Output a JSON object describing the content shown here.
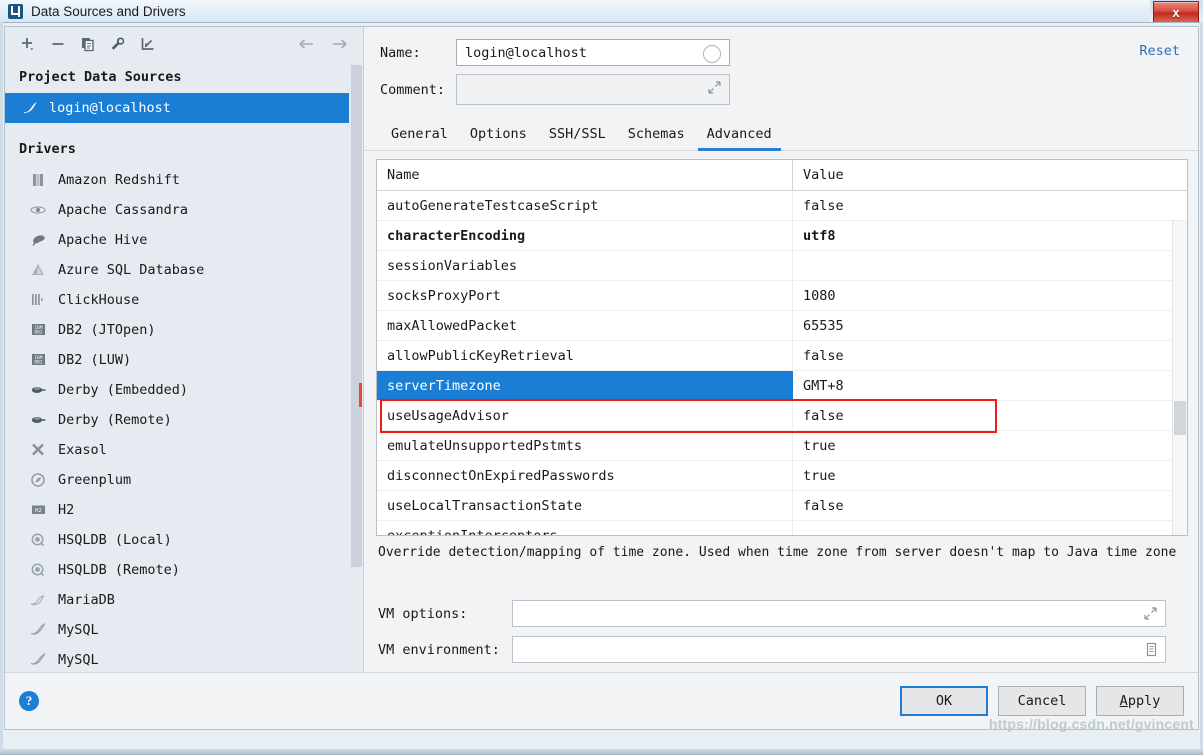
{
  "window": {
    "title": "Data Sources and Drivers",
    "logo_icon": "intellij-idea-logo-icon",
    "close_label": "x"
  },
  "left_panel": {
    "toolbar": [
      {
        "name": "add-button",
        "icon": "plus-icon",
        "label": "+"
      },
      {
        "name": "remove-button",
        "icon": "minus-icon",
        "label": "−"
      },
      {
        "name": "copy-button",
        "icon": "copy-icon",
        "label": "copy"
      },
      {
        "name": "properties-button",
        "icon": "wrench-icon",
        "label": "wrench"
      },
      {
        "name": "import-button",
        "icon": "import-arrow-icon",
        "label": "import"
      },
      {
        "name": "back-button",
        "icon": "arrow-left-icon",
        "label": "←"
      },
      {
        "name": "forward-button",
        "icon": "arrow-right-icon",
        "label": "→"
      }
    ],
    "project_group_label": "Project Data Sources",
    "data_sources": [
      {
        "label": "login@localhost",
        "icon": "mysql-dolphin-icon",
        "selected": true
      }
    ],
    "drivers_group_label": "Drivers",
    "drivers": [
      {
        "label": "Amazon Redshift",
        "icon": "amazon-redshift-icon"
      },
      {
        "label": "Apache Cassandra",
        "icon": "apache-cassandra-icon"
      },
      {
        "label": "Apache Hive",
        "icon": "apache-hive-icon"
      },
      {
        "label": "Azure SQL Database",
        "icon": "azure-sql-icon"
      },
      {
        "label": "ClickHouse",
        "icon": "clickhouse-icon"
      },
      {
        "label": "DB2 (JTOpen)",
        "icon": "ibm-db2-icon"
      },
      {
        "label": "DB2 (LUW)",
        "icon": "ibm-db2-icon"
      },
      {
        "label": "Derby (Embedded)",
        "icon": "derby-icon"
      },
      {
        "label": "Derby (Remote)",
        "icon": "derby-icon"
      },
      {
        "label": "Exasol",
        "icon": "exasol-icon"
      },
      {
        "label": "Greenplum",
        "icon": "greenplum-icon"
      },
      {
        "label": "H2",
        "icon": "h2-icon"
      },
      {
        "label": "HSQLDB (Local)",
        "icon": "hsqldb-icon"
      },
      {
        "label": "HSQLDB (Remote)",
        "icon": "hsqldb-icon"
      },
      {
        "label": "MariaDB",
        "icon": "mariadb-seal-icon"
      },
      {
        "label": "MySQL",
        "icon": "mysql-dolphin-icon"
      },
      {
        "label": "MySQL",
        "icon": "mysql-dolphin-icon"
      }
    ]
  },
  "right_panel": {
    "name_label": "Name:",
    "name_value": "login@localhost",
    "name_placeholder": "",
    "comment_label": "Comment:",
    "comment_value": "",
    "comment_placeholder": "",
    "reset_label": "Reset",
    "tabs": [
      {
        "label": "General",
        "active": false
      },
      {
        "label": "Options",
        "active": false
      },
      {
        "label": "SSH/SSL",
        "active": false
      },
      {
        "label": "Schemas",
        "active": false
      },
      {
        "label": "Advanced",
        "active": true
      }
    ],
    "table": {
      "columns": [
        "Name",
        "Value"
      ],
      "rows": [
        {
          "name": "autoGenerateTestcaseScript",
          "value": "false",
          "bold": false,
          "selected": false
        },
        {
          "name": "characterEncoding",
          "value": "utf8",
          "bold": true,
          "selected": false
        },
        {
          "name": "sessionVariables",
          "value": "",
          "bold": false,
          "selected": false
        },
        {
          "name": "socksProxyPort",
          "value": "1080",
          "bold": false,
          "selected": false
        },
        {
          "name": "maxAllowedPacket",
          "value": "65535",
          "bold": false,
          "selected": false
        },
        {
          "name": "allowPublicKeyRetrieval",
          "value": "false",
          "bold": false,
          "selected": false
        },
        {
          "name": "serverTimezone",
          "value": "GMT+8",
          "bold": false,
          "selected": true
        },
        {
          "name": "useUsageAdvisor",
          "value": "false",
          "bold": false,
          "selected": false
        },
        {
          "name": "emulateUnsupportedPstmts",
          "value": "true",
          "bold": false,
          "selected": false
        },
        {
          "name": "disconnectOnExpiredPasswords",
          "value": "true",
          "bold": false,
          "selected": false
        },
        {
          "name": "useLocalTransactionState",
          "value": "false",
          "bold": false,
          "selected": false
        },
        {
          "name": "exceptionInterceptors",
          "value": "",
          "bold": false,
          "selected": false
        }
      ]
    },
    "description": "Override detection/mapping of time zone. Used when time zone from server doesn't map to Java time zone",
    "vm_options_label": "VM options:",
    "vm_options_value": "",
    "vm_environment_label": "VM environment:",
    "vm_environment_value": ""
  },
  "footer": {
    "help_label": "?",
    "ok_label": "OK",
    "cancel_label": "Cancel",
    "apply_label": "Apply",
    "watermark": "https://blog.csdn.net/gvincent"
  },
  "colors": {
    "accent_blue": "#1a7fd4",
    "selection_outline_red": "#ee1c19",
    "link_blue": "#2a6fb5",
    "panel_bg": "#f1f3f4",
    "sidebar_bg": "#e5ebf0"
  }
}
